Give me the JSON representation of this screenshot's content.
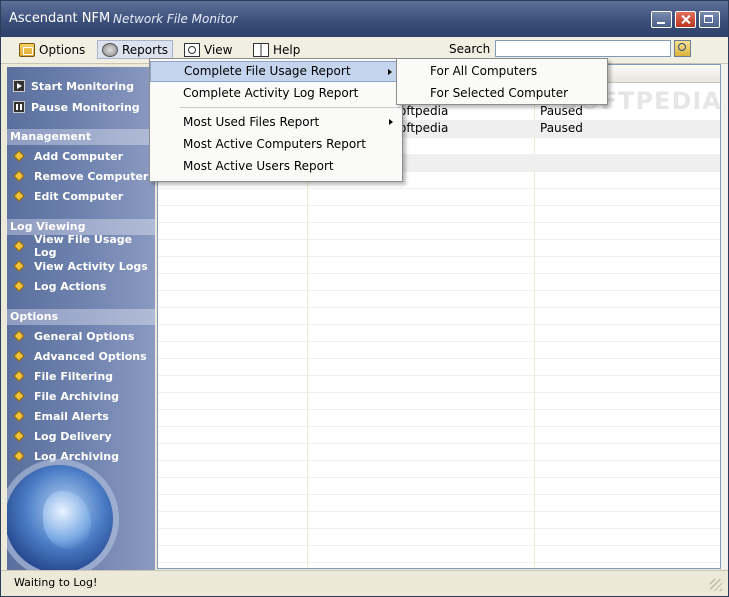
{
  "window": {
    "app_name": "Ascendant NFM",
    "subtitle": "Network File Monitor"
  },
  "menubar": {
    "options": "Options",
    "reports": "Reports",
    "view": "View",
    "help": "Help"
  },
  "search": {
    "label": "Search",
    "value": ""
  },
  "sidebar": {
    "monitoring": [
      "Start Monitoring",
      "Pause Monitoring"
    ],
    "management_header": "Management",
    "management": [
      "Add Computer",
      "Remove Computer",
      "Edit Computer"
    ],
    "logviewing_header": "Log Viewing",
    "logviewing": [
      "View File Usage Log",
      "View Activity Logs",
      "Log Actions"
    ],
    "options_header": "Options",
    "options": [
      "General Options",
      "Advanced Options",
      "File Filtering",
      "File Archiving",
      "Email Alerts",
      "Log Delivery",
      "Log Archiving"
    ]
  },
  "grid": {
    "rows": [
      {
        "name": "oftpedia",
        "status": "Paused"
      },
      {
        "name": "oftpedia",
        "status": "Paused"
      }
    ]
  },
  "reports_menu": {
    "items": [
      "Complete File Usage Report",
      "Complete Activity Log Report",
      "Most Used Files Report",
      "Most Active Computers Report",
      "Most Active Users Report"
    ],
    "submenu": [
      "For All Computers",
      "For Selected Computer"
    ]
  },
  "status": {
    "text": "Waiting to Log!"
  },
  "watermark": "SOFTPEDIA",
  "colors": {
    "titlebar": "#3a4d78",
    "sidebar": "#7184b0",
    "highlight": "#c4d4ec"
  }
}
